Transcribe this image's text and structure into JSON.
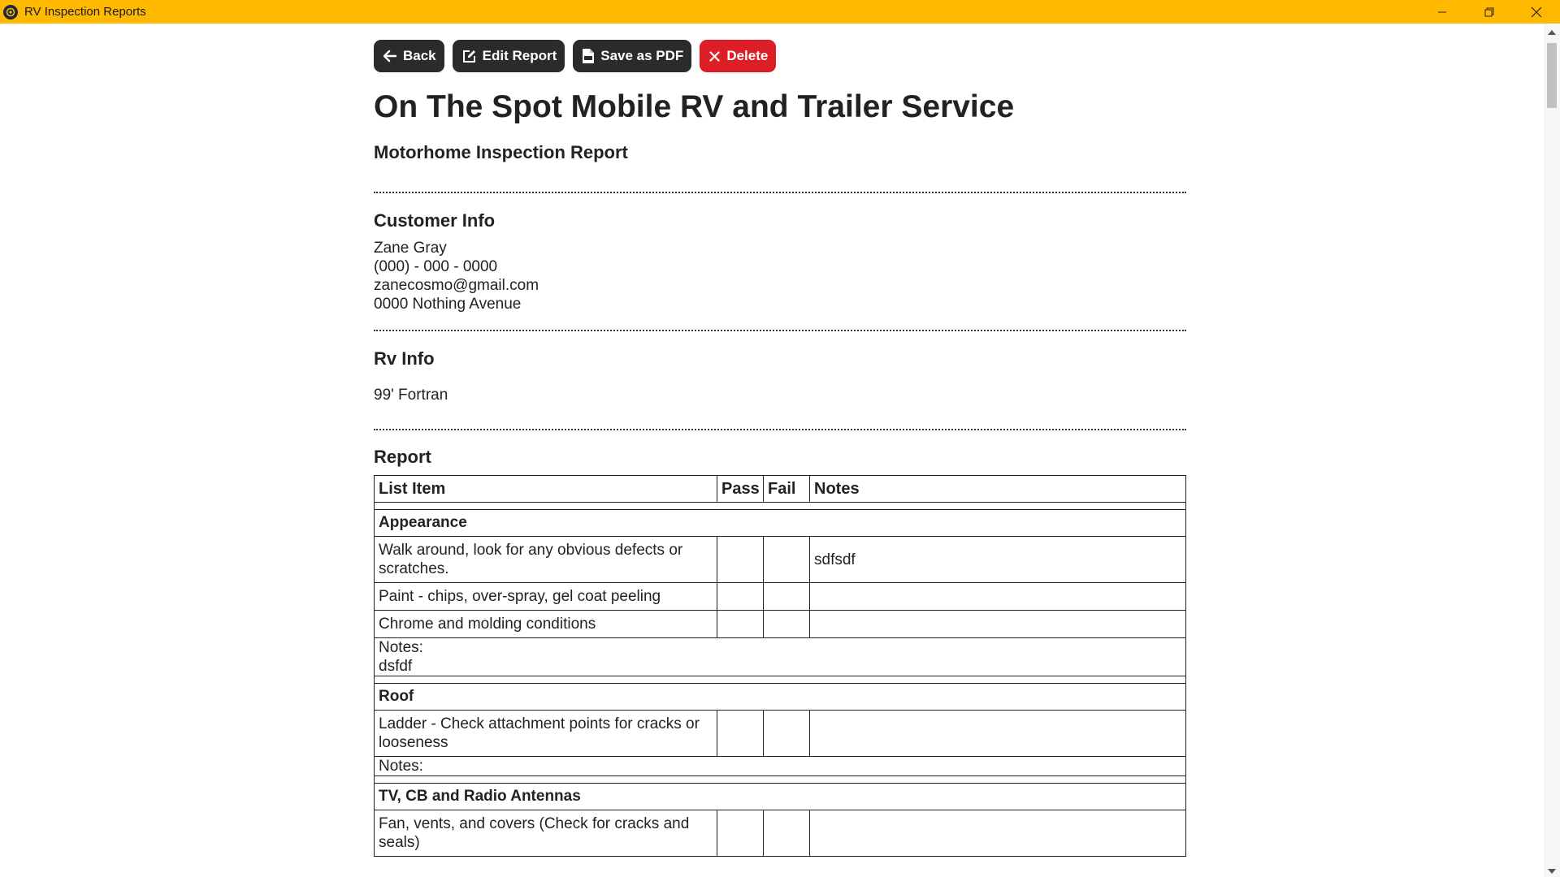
{
  "window": {
    "title": "RV Inspection Reports",
    "bar_color": "#ffb900",
    "icons": [
      "app-icon",
      "minimize-icon",
      "restore-icon",
      "close-icon"
    ]
  },
  "toolbar": {
    "back_label": "Back",
    "edit_label": "Edit Report",
    "pdf_label": "Save as PDF",
    "delete_label": "Delete",
    "delete_color": "#dc1f26"
  },
  "report": {
    "company": "On The Spot Mobile RV and Trailer Service",
    "type": "Motorhome Inspection Report",
    "customer_heading": "Customer Info",
    "customer": {
      "name": "Zane Gray",
      "phone": "(000) - 000 - 0000",
      "email": "zanecosmo@gmail.com",
      "address": "0000 Nothing Avenue"
    },
    "rv_heading": "Rv Info",
    "rv": "99' Fortran",
    "report_heading": "Report"
  },
  "table": {
    "headers": [
      "List Item",
      "Pass",
      "Fail",
      "Notes"
    ],
    "sections": [
      {
        "title": "Appearance",
        "items": [
          {
            "item": "Walk around, look for any obvious defects or scratches.",
            "pass": "",
            "fail": "",
            "notes": "sdfsdf"
          },
          {
            "item": "Paint - chips, over-spray, gel coat peeling",
            "pass": "",
            "fail": "",
            "notes": ""
          },
          {
            "item": "Chrome and molding conditions",
            "pass": "",
            "fail": "",
            "notes": ""
          }
        ],
        "notes_label": "Notes:",
        "notes": "dsfdf"
      },
      {
        "title": "Roof",
        "items": [
          {
            "item": "Ladder - Check attachment points for cracks or looseness",
            "pass": "",
            "fail": "",
            "notes": ""
          }
        ],
        "notes_label": "Notes:",
        "notes": ""
      },
      {
        "title": "TV, CB and Radio Antennas",
        "items": [
          {
            "item": "Fan, vents, and covers (Check for cracks and seals)",
            "pass": "",
            "fail": "",
            "notes": ""
          }
        ]
      }
    ]
  }
}
